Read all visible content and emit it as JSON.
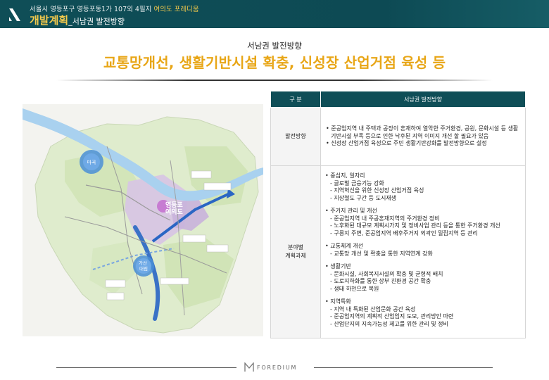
{
  "header": {
    "address": "서울시 영등포구 영등포동1가 107외 4필지",
    "project": "여의도 포레디움",
    "title": "개발계획",
    "subtitle": "_서남권 발전방향"
  },
  "subheading": "서남권 발전방향",
  "headline": "교통망개선, 생활기반시설 확충, 신성장 산업거점 육성 등",
  "map": {
    "labels": {
      "magok": "마곡",
      "yeongdeungpo": "영등포\n여의도",
      "gasan": "가산\n대림"
    }
  },
  "table": {
    "header_left": "구   분",
    "header_right": "서남권 발전방향",
    "row1_label": "발전방향",
    "row1_bullets": [
      "• 준공업지역 내 주택과 공장이 혼재하여 열악한 주거환경, 공원, 문화시설 등 생활기반시설 부족 등으로 인한 낙후된 지역 이미지 개선 할 필요가 있음",
      "• 신성장 산업거점 육성으로 주민 생활기반강화를 발전방향으로 설정"
    ],
    "row2_label_1": "분야별",
    "row2_label_2": "계획과제",
    "sections": [
      {
        "title": "• 중심지, 일자리",
        "items": [
          "- 글로벌 금융기능 강화",
          "- 지역혁신을 위한 신성장 산업거점 육성",
          "- 지상철도 구간 등 도시재생"
        ]
      },
      {
        "title": "• 주거지 관리 및 개선",
        "items": [
          "- 준공업지역 내 주공혼재지역의 주거환경 정비",
          "- 노후화된 대규모 계획시가지 및 정비사업 관리 등을 통한 주거환경 개선",
          "- 구릉지 주변, 준공업지역 배후주거지 외곽인 밀집지역 등 관리"
        ]
      },
      {
        "title": "• 교통체계 개선",
        "items": [
          "- 교통망 개선 및 확충을 통한 지역연계 강화"
        ]
      },
      {
        "title": "• 생활기반",
        "items": [
          "- 문화시설, 사회복지시설의 확충 및 균형적 배치",
          "- 도로지하화를 통한 상부 친환경 공간 확충",
          "- 생태 하천으로 복원"
        ]
      },
      {
        "title": "• 지역특화",
        "items": [
          "- 지역 내 특화된 산업문화 공간 육성",
          "- 준공업지역의 계획적 산업입지 도모, 관리방안 마련",
          "- 산업단지의 지속가능성 제고를 위한 관리 및 정비"
        ]
      }
    ]
  },
  "footer": {
    "brand": "FOREDIUM"
  },
  "colors": {
    "header_bg": "#0f4e57",
    "accent_gold": "#e8a617",
    "table_header": "#0f4e57"
  }
}
